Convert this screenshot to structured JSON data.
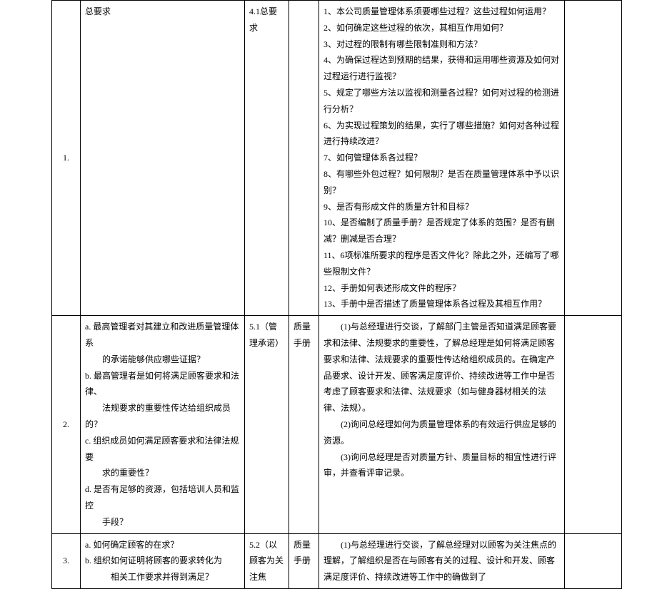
{
  "rows": [
    {
      "num": "1.",
      "col2": "总要求",
      "col3": "4.1总要求",
      "col4": "",
      "col5_lines": [
        "",
        "1、本公司质量管理体系须要哪些过程？这些过程如何运用？",
        "2、如何确定这些过程的依次，其相互作用如何？",
        "3、对过程的限制有哪些限制准则和方法？",
        "4、为确保过程达到预期的结果，获得和运用哪些资源及如何对过程运行进行监视？",
        "5、规定了哪些方法以监视和测量各过程？如何对过程的检测进行分析？",
        "6、为实现过程策划的结果，实行了哪些措施？如何对各种过程进行持续改进？",
        "7、如何管理体系各过程？",
        "8、有哪些外包过程？如何限制？是否在质量管理体系中予以识别？",
        "9、是否有形成文件的质量方针和目标？",
        "10、是否编制了质量手册？是否规定了体系的范围？是否有删减？删减是否合理？",
        "11、6项标准所要求的程序是否文件化？除此之外，还编写了哪些限制文件？",
        "12、手册如何表述形成文件的程序？",
        "13、手册中是否描述了质量管理体系各过程及其相互作用？"
      ]
    },
    {
      "num": "2.",
      "col2_lines": [
        "a. 最高管理者对其建立和改进质量管理体系",
        "　　的承诺能够供应哪些证据？",
        "b. 最高管理者是如何将满足顾客要求和法律、",
        "　　法规要求的重要性传达给组织成员的？",
        "c. 组织成员如何满足顾客要求和法律法规要",
        "　　求的重要性？",
        "d. 是否有足够的资源，包括培训人员和监控",
        "　　手段？"
      ],
      "col3": "5.1（管理承诺）",
      "col4": "质量手册",
      "col5_lines": [
        "　　(1)与总经理进行交谈，了解部门主管是否知道满足顾客要求和法律、法规要求的重要性，了解总经理是如何将满足顾客要求和法律、法规要求的重要性传达给组织成员的。在确定产品要求、设计开发、顾客满足度评价、持续改进等工作中是否考虑了顾客要求和法律、法规要求（如与健身器材相关的法律、法规）。",
        "　　(2)询问总经理如何为质量管理体系的有效运行供应足够的资源。",
        "　　(3)询问总经理是否对质量方针、质量目标的相宜性进行评审，并查看评审记录。"
      ]
    },
    {
      "num": "3.",
      "col2_lines": [
        "a. 如何确定顾客的在求？",
        "b. 组织如何证明将顾客的要求转化为",
        "　　　相关工作要求并得到满足？"
      ],
      "col3": "5.2（以顾客为关注焦",
      "col4": "质量手册",
      "col5_lines": [
        "　　(1)与总经理进行交谈，了解总经理对以顾客为关注焦点的理解，了解组织是否在与顾客有关的过程、设计和开发、顾客满足度评价、持续改进等工作中的确做到了"
      ]
    }
  ]
}
